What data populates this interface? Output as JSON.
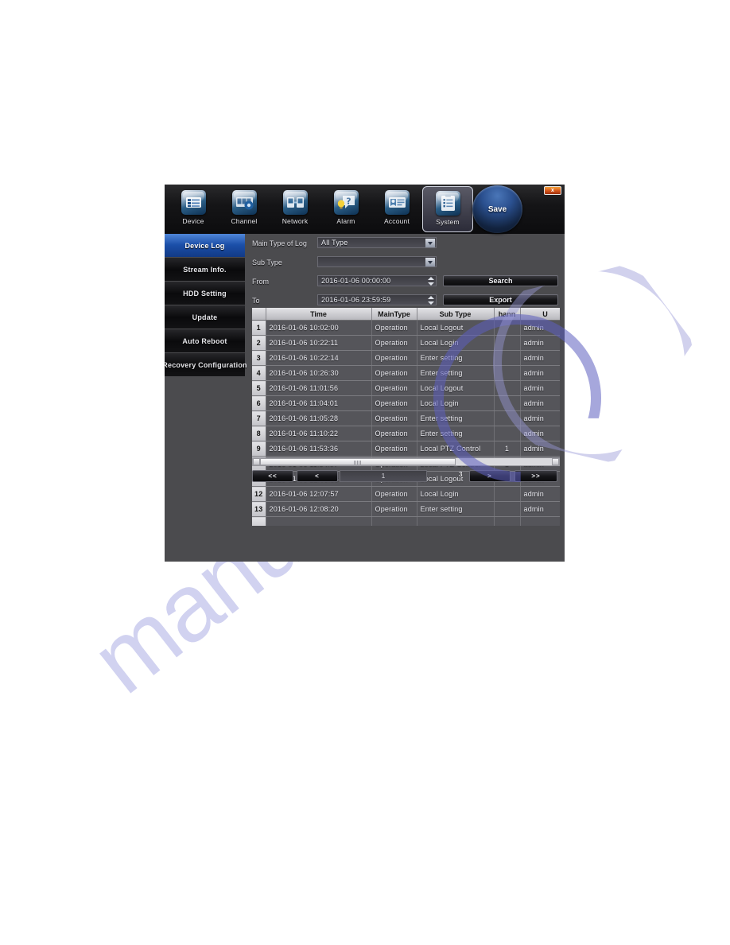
{
  "window": {
    "close_label": "x",
    "save_label": "Save"
  },
  "toolbar": {
    "items": [
      {
        "label": "Device",
        "icon": "device-icon",
        "selected": false
      },
      {
        "label": "Channel",
        "icon": "channel-icon",
        "selected": false
      },
      {
        "label": "Network",
        "icon": "network-icon",
        "selected": false
      },
      {
        "label": "Alarm",
        "icon": "alarm-icon",
        "selected": false
      },
      {
        "label": "Account",
        "icon": "account-icon",
        "selected": false
      },
      {
        "label": "System",
        "icon": "system-icon",
        "selected": true
      }
    ]
  },
  "sidebar": {
    "items": [
      {
        "label": "Device Log",
        "selected": true
      },
      {
        "label": "Stream Info.",
        "selected": false
      },
      {
        "label": "HDD Setting",
        "selected": false
      },
      {
        "label": "Update",
        "selected": false
      },
      {
        "label": "Auto Reboot",
        "selected": false
      },
      {
        "label": "Recovery Configuration",
        "selected": false
      }
    ]
  },
  "form": {
    "main_type_label": "Main Type of Log",
    "main_type_value": "All Type",
    "sub_type_label": "Sub Type",
    "sub_type_value": "",
    "from_label": "From",
    "from_value": "2016-01-06 00:00:00",
    "to_label": "To",
    "to_value": "2016-01-06 23:59:59",
    "search_label": "Search",
    "export_label": "Export"
  },
  "table": {
    "columns": [
      "",
      "Time",
      "MainType",
      "Sub Type",
      "hann",
      "U",
      ""
    ],
    "rows": [
      {
        "no": "1",
        "time": "2016-01-06 10:02:00",
        "main": "Operation",
        "sub": "Local Logout",
        "channel": "",
        "user": "admin"
      },
      {
        "no": "2",
        "time": "2016-01-06 10:22:11",
        "main": "Operation",
        "sub": "Local Login",
        "channel": "",
        "user": "admin"
      },
      {
        "no": "3",
        "time": "2016-01-06 10:22:14",
        "main": "Operation",
        "sub": "Enter setting",
        "channel": "",
        "user": "admin"
      },
      {
        "no": "4",
        "time": "2016-01-06 10:26:30",
        "main": "Operation",
        "sub": "Enter setting",
        "channel": "",
        "user": "admin"
      },
      {
        "no": "5",
        "time": "2016-01-06 11:01:56",
        "main": "Operation",
        "sub": "Local Logout",
        "channel": "",
        "user": "admin"
      },
      {
        "no": "6",
        "time": "2016-01-06 11:04:01",
        "main": "Operation",
        "sub": "Local Login",
        "channel": "",
        "user": "admin"
      },
      {
        "no": "7",
        "time": "2016-01-06 11:05:28",
        "main": "Operation",
        "sub": "Enter setting",
        "channel": "",
        "user": "admin"
      },
      {
        "no": "8",
        "time": "2016-01-06 11:10:22",
        "main": "Operation",
        "sub": "Enter setting",
        "channel": "",
        "user": "admin"
      },
      {
        "no": "9",
        "time": "2016-01-06 11:53:36",
        "main": "Operation",
        "sub": "Local PTZ Control",
        "channel": "1",
        "user": "admin"
      },
      {
        "no": "10",
        "time": "2016-01-06 11:54:07",
        "main": "Operation",
        "sub": "Local PTZ Control",
        "channel": "1",
        "user": "admin"
      },
      {
        "no": "11",
        "time": "2016-01-06 12:05:53",
        "main": "Operation",
        "sub": "Local Logout",
        "channel": "",
        "user": "admin"
      },
      {
        "no": "12",
        "time": "2016-01-06 12:07:57",
        "main": "Operation",
        "sub": "Local Login",
        "channel": "",
        "user": "admin"
      },
      {
        "no": "13",
        "time": "2016-01-06 12:08:20",
        "main": "Operation",
        "sub": "Enter setting",
        "channel": "",
        "user": "admin"
      }
    ]
  },
  "pager": {
    "first_label": "<<",
    "prev_label": "<",
    "page_value": "1",
    "total_pages": "3",
    "next_label": ">",
    "last_label": ">>"
  },
  "watermark": {
    "text": "manu"
  }
}
